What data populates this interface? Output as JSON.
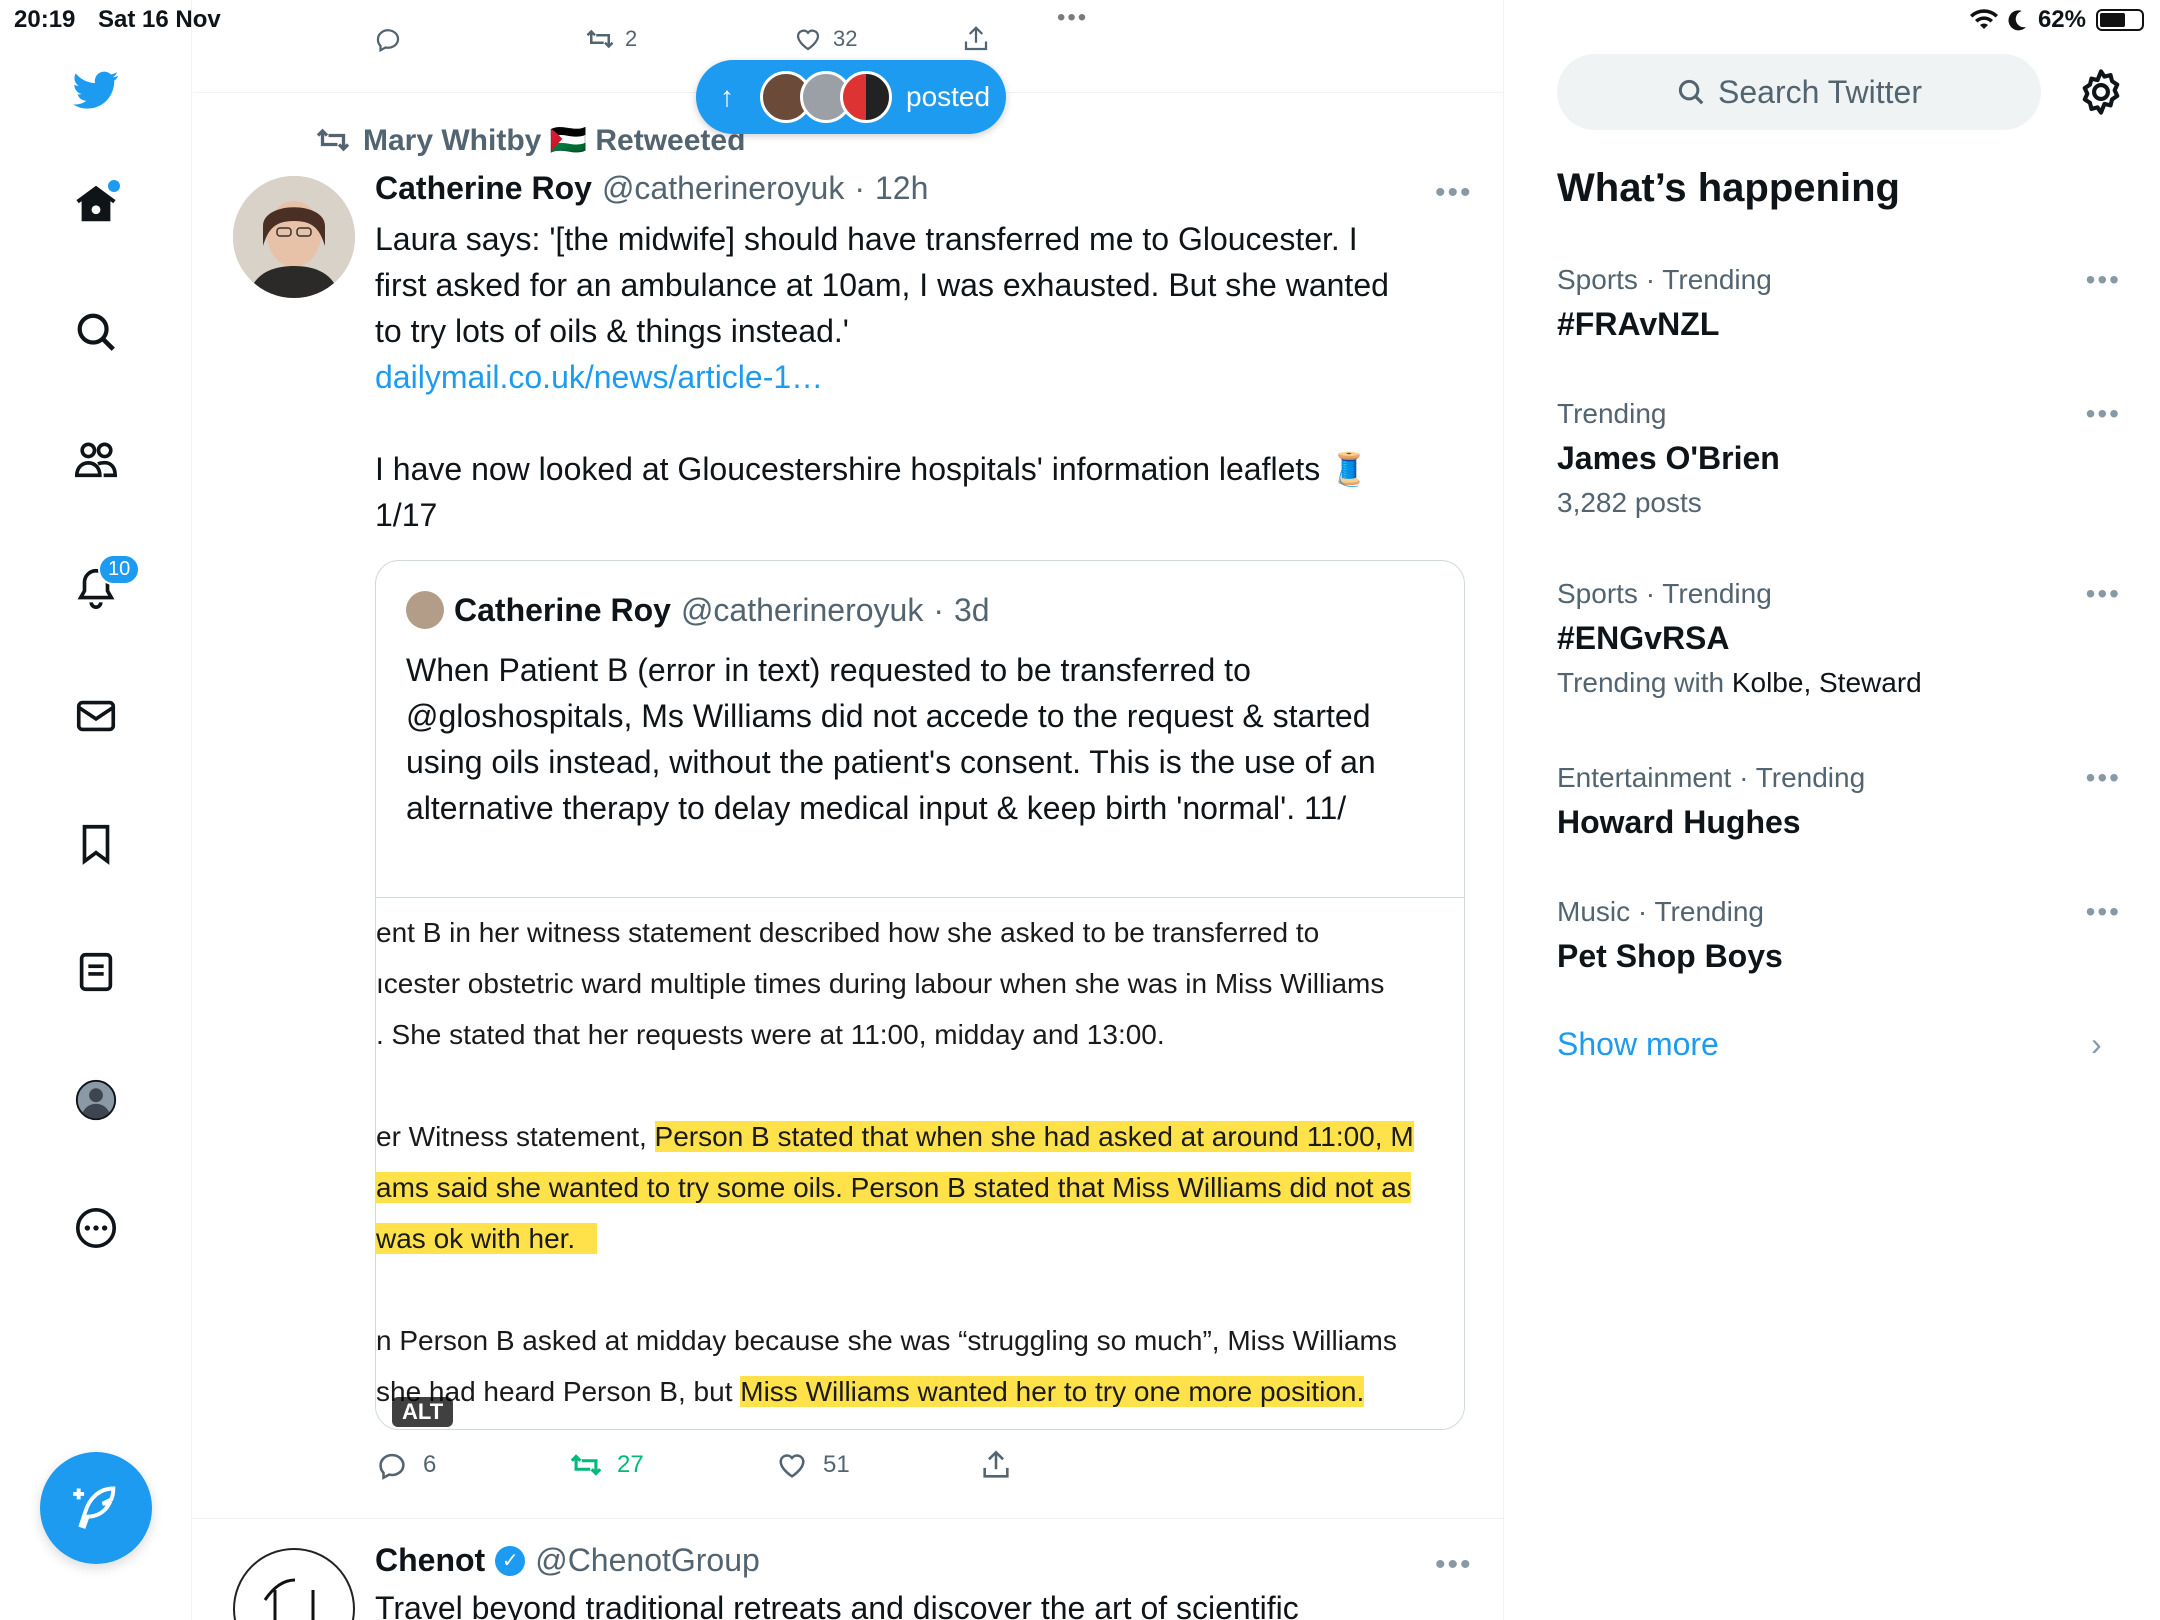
{
  "status_bar": {
    "time": "20:19",
    "date": "Sat 16 Nov",
    "battery": "62%",
    "dots": "•••"
  },
  "nav": {
    "notifications_count": "10"
  },
  "previous_tweet_actions": {
    "retweets": "2",
    "likes": "32"
  },
  "new_posts_pill": {
    "label": "posted",
    "arrow": "↑"
  },
  "tweet": {
    "retweeted_by": "Mary Whitby 🇵🇸 Retweeted",
    "author_name": "Catherine Roy",
    "author_handle": "@catherineroyuk",
    "separator": "·",
    "time_ago": "12h",
    "more": "•••",
    "text_lines": [
      "Laura says: '[the midwife] should have transferred me to Gloucester. I",
      "first asked for an ambulance at 10am, I was exhausted. But she wanted",
      "to try lots of oils & things instead.'"
    ],
    "link": "dailymail.co.uk/news/article-1…",
    "text_line_2": "I have now looked at Gloucestershire hospitals' information leaflets 🧵",
    "text_line_3": "1/17",
    "quote": {
      "author_name": "Catherine Roy",
      "author_handle": "@catherineroyuk",
      "separator": "·",
      "time_ago": "3d",
      "text": "When Patient B (error in text) requested to be transferred to @gloshospitals, Ms Williams did not accede to the request & started using oils instead, without the patient's consent. This is the use of an alternative therapy to delay medical input & keep birth 'normal'. 11/",
      "image_lines": [
        {
          "plain": "ent B in her witness statement described how she asked to be transferred to"
        },
        {
          "plain": "ıcester obstetric ward multiple times during labour when she was in Miss Williams"
        },
        {
          "plain": ". She stated that her requests were at 11:00, midday and 13:00."
        },
        {
          "plain": "er Witness statement, ",
          "highlight": "Person B stated that when she had asked at around 11:00, M"
        },
        {
          "highlight": "ams said she wanted to try some oils. Person B stated that Miss Williams did not as"
        },
        {
          "highlight": "was ok with her."
        },
        {
          "plain": "n Person B asked at midday because she was “struggling so much”, Miss Williams"
        },
        {
          "plain": "she had heard Person B, but ",
          "highlight": "Miss Williams wanted her to try one more position."
        }
      ],
      "alt_badge": "ALT"
    },
    "actions": {
      "replies": "6",
      "retweets": "27",
      "likes": "51"
    }
  },
  "next_tweet": {
    "author_name": "Chenot",
    "author_handle": "@ChenotGroup",
    "text": "Travel beyond traditional retreats and discover the art of scientific",
    "more": "•••"
  },
  "sidebar": {
    "search_placeholder": "Search Twitter",
    "heading": "What’s happening",
    "trends": [
      {
        "category": "Sports · Trending",
        "title": "#FRAvNZL",
        "more": "•••"
      },
      {
        "category": "Trending",
        "title": "James O'Brien",
        "sub": "3,282 posts",
        "more": "•••"
      },
      {
        "category": "Sports · Trending",
        "title": "#ENGvRSA",
        "sub_prefix": "Trending with ",
        "sub_names": "Kolbe, Steward",
        "more": "•••"
      },
      {
        "category": "Entertainment · Trending",
        "title": "Howard Hughes",
        "more": "•••"
      },
      {
        "category": "Music · Trending",
        "title": "Pet Shop Boys",
        "more": "•••"
      }
    ],
    "show_more": "Show more",
    "show_more_chevron": "›"
  },
  "colors": {
    "accent": "#1d9bf0",
    "retweet_green": "#00ba7c",
    "highlight": "#ffe24a",
    "muted": "#536471"
  }
}
